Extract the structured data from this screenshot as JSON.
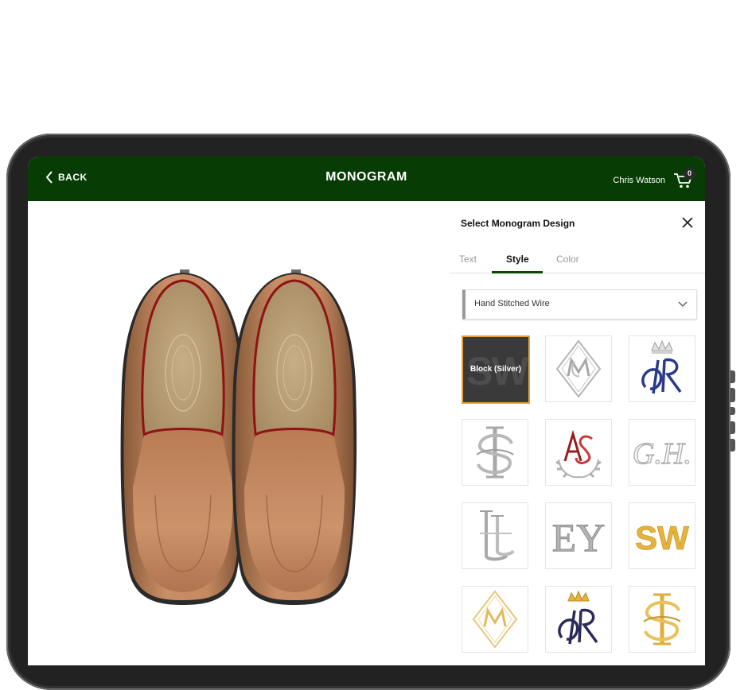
{
  "header": {
    "back_label": "BACK",
    "title": "MONOGRAM",
    "user_name": "Chris Watson",
    "cart_count": "0"
  },
  "panel": {
    "title": "Select Monogram Design",
    "tabs": [
      {
        "label": "Text",
        "active": false
      },
      {
        "label": "Style",
        "active": true
      },
      {
        "label": "Color",
        "active": false
      }
    ],
    "dropdown": {
      "selected": "Hand Stitched Wire"
    },
    "tiles": [
      {
        "label": "Block (Silver)",
        "glyph": "SW",
        "selected": true
      },
      {
        "glyph": "diamond-monogram-silver"
      },
      {
        "glyph": "crown-monogram-navy"
      },
      {
        "glyph": "interlock-monogram-silver"
      },
      {
        "glyph": "wreath-monogram-red"
      },
      {
        "glyph": "GH",
        "text": "G.H."
      },
      {
        "glyph": "interlock-LL-silver"
      },
      {
        "glyph": "EY",
        "text": "EY"
      },
      {
        "glyph": "SW-gold",
        "text": "SW"
      },
      {
        "glyph": "diamond-monogram-gold"
      },
      {
        "glyph": "crown-monogram-navy-gold"
      },
      {
        "glyph": "interlock-monogram-gold"
      }
    ]
  },
  "colors": {
    "header_bg": "#073d04",
    "accent_underline": "#0a4a07",
    "selected_border": "#e9a23b",
    "silver": "#a8a8a8",
    "navy": "#2a3a8a",
    "red": "#9b1c1c",
    "gold": "#e6b43c"
  }
}
